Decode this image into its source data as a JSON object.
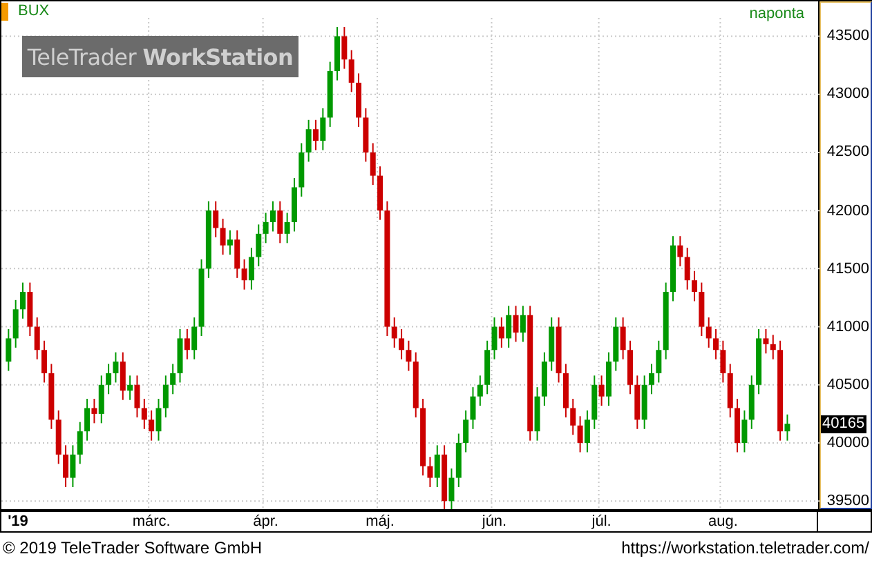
{
  "chart": {
    "symbol": "BUX",
    "interval": "naponta",
    "logo": "TeleTrader **WorkStation**",
    "last_price": "40165",
    "year_label": "'19",
    "chart_data": {
      "type": "candlestick",
      "grid": true,
      "ylim": [
        39430,
        43800
      ],
      "categories": [
        null,
        null,
        null,
        null,
        null,
        null,
        null,
        null,
        null,
        null,
        null,
        null,
        null,
        null,
        null,
        null,
        null,
        null,
        null,
        null,
        "márc.",
        null,
        null,
        null,
        null,
        null,
        null,
        null,
        null,
        null,
        null,
        null,
        null,
        null,
        null,
        null,
        "ápr.",
        null,
        null,
        null,
        null,
        null,
        null,
        null,
        null,
        null,
        null,
        null,
        null,
        null,
        null,
        null,
        "máj.",
        null,
        null,
        null,
        null,
        null,
        null,
        null,
        null,
        null,
        null,
        null,
        null,
        null,
        null,
        null,
        "jún.",
        null,
        null,
        null,
        null,
        null,
        null,
        null,
        null,
        null,
        null,
        null,
        null,
        null,
        null,
        "júl.",
        null,
        null,
        null,
        null,
        null,
        null,
        null,
        null,
        null,
        null,
        null,
        null,
        null,
        null,
        null,
        null,
        "aug.",
        null,
        null,
        null,
        null,
        null,
        null,
        null,
        null,
        null
      ],
      "ohlc": [
        [
          40700,
          40980,
          40620,
          40900
        ],
        [
          40900,
          41230,
          40820,
          41150
        ],
        [
          41150,
          41380,
          41070,
          41300
        ],
        [
          41300,
          41380,
          40920,
          41000
        ],
        [
          41000,
          41080,
          40720,
          40800
        ],
        [
          40800,
          40880,
          40520,
          40600
        ],
        [
          40600,
          40680,
          40120,
          40200
        ],
        [
          40200,
          40280,
          39820,
          39900
        ],
        [
          39900,
          39980,
          39620,
          39700
        ],
        [
          39700,
          39980,
          39620,
          39900
        ],
        [
          39900,
          40180,
          39820,
          40100
        ],
        [
          40100,
          40380,
          40020,
          40300
        ],
        [
          40300,
          40380,
          40170,
          40250
        ],
        [
          40250,
          40580,
          40170,
          40500
        ],
        [
          40500,
          40680,
          40420,
          40600
        ],
        [
          40600,
          40780,
          40520,
          40700
        ],
        [
          40700,
          40780,
          40370,
          40450
        ],
        [
          40450,
          40580,
          40370,
          40500
        ],
        [
          40500,
          40580,
          40220,
          40300
        ],
        [
          40300,
          40380,
          40120,
          40200
        ],
        [
          40200,
          40280,
          40020,
          40100
        ],
        [
          40100,
          40380,
          40020,
          40300
        ],
        [
          40300,
          40580,
          40220,
          40500
        ],
        [
          40500,
          40680,
          40420,
          40600
        ],
        [
          40600,
          40980,
          40520,
          40900
        ],
        [
          40900,
          40980,
          40720,
          40800
        ],
        [
          40800,
          41080,
          40720,
          41000
        ],
        [
          41000,
          41580,
          40920,
          41500
        ],
        [
          41500,
          42080,
          41420,
          42000
        ],
        [
          42000,
          42080,
          41770,
          41850
        ],
        [
          41850,
          41930,
          41620,
          41700
        ],
        [
          41700,
          41830,
          41620,
          41750
        ],
        [
          41750,
          41830,
          41420,
          41500
        ],
        [
          41500,
          41580,
          41320,
          41400
        ],
        [
          41400,
          41680,
          41320,
          41600
        ],
        [
          41600,
          41880,
          41520,
          41800
        ],
        [
          41800,
          41980,
          41720,
          41900
        ],
        [
          41900,
          42080,
          41820,
          42000
        ],
        [
          42000,
          42080,
          41720,
          41800
        ],
        [
          41800,
          41980,
          41720,
          41900
        ],
        [
          41900,
          42280,
          41820,
          42200
        ],
        [
          42200,
          42580,
          42120,
          42500
        ],
        [
          42500,
          42780,
          42420,
          42700
        ],
        [
          42700,
          42780,
          42520,
          42600
        ],
        [
          42600,
          42880,
          42520,
          42800
        ],
        [
          42800,
          43280,
          42720,
          43200
        ],
        [
          43200,
          43580,
          43120,
          43500
        ],
        [
          43500,
          43580,
          43220,
          43300
        ],
        [
          43300,
          43380,
          43020,
          43100
        ],
        [
          43100,
          43180,
          42720,
          42800
        ],
        [
          42800,
          42880,
          42420,
          42500
        ],
        [
          42500,
          42580,
          42220,
          42300
        ],
        [
          42300,
          42380,
          41920,
          42000
        ],
        [
          42000,
          42080,
          40920,
          41000
        ],
        [
          41000,
          41080,
          40820,
          40900
        ],
        [
          40900,
          40980,
          40720,
          40800
        ],
        [
          40800,
          40880,
          40620,
          40700
        ],
        [
          40700,
          40780,
          40220,
          40300
        ],
        [
          40300,
          40380,
          39720,
          39800
        ],
        [
          39800,
          39880,
          39620,
          39700
        ],
        [
          39700,
          39980,
          39620,
          39900
        ],
        [
          39900,
          39980,
          39420,
          39500
        ],
        [
          39500,
          39780,
          39420,
          39700
        ],
        [
          39700,
          40080,
          39620,
          40000
        ],
        [
          40000,
          40280,
          39920,
          40200
        ],
        [
          40200,
          40480,
          40120,
          40400
        ],
        [
          40400,
          40580,
          40320,
          40500
        ],
        [
          40500,
          40880,
          40420,
          40800
        ],
        [
          40800,
          41080,
          40720,
          41000
        ],
        [
          41000,
          41080,
          40820,
          40900
        ],
        [
          40900,
          41180,
          40820,
          41100
        ],
        [
          41100,
          41180,
          40870,
          40950
        ],
        [
          40950,
          41180,
          40870,
          41100
        ],
        [
          41100,
          41180,
          40020,
          40100
        ],
        [
          40100,
          40480,
          40020,
          40400
        ],
        [
          40400,
          40780,
          40320,
          40700
        ],
        [
          40700,
          41080,
          40620,
          41000
        ],
        [
          41000,
          41080,
          40520,
          40600
        ],
        [
          40600,
          40680,
          40220,
          40300
        ],
        [
          40300,
          40380,
          40070,
          40150
        ],
        [
          40150,
          40230,
          39920,
          40000
        ],
        [
          40000,
          40280,
          39920,
          40200
        ],
        [
          40200,
          40580,
          40120,
          40500
        ],
        [
          40500,
          40580,
          40320,
          40400
        ],
        [
          40400,
          40780,
          40320,
          40700
        ],
        [
          40700,
          41080,
          40620,
          41000
        ],
        [
          41000,
          41080,
          40720,
          40800
        ],
        [
          40800,
          40880,
          40420,
          40500
        ],
        [
          40500,
          40580,
          40120,
          40200
        ],
        [
          40200,
          40580,
          40120,
          40500
        ],
        [
          40500,
          40680,
          40420,
          40600
        ],
        [
          40600,
          40880,
          40520,
          40800
        ],
        [
          40800,
          41380,
          40720,
          41300
        ],
        [
          41300,
          41780,
          41220,
          41700
        ],
        [
          41700,
          41780,
          41520,
          41600
        ],
        [
          41600,
          41680,
          41320,
          41400
        ],
        [
          41400,
          41480,
          41220,
          41300
        ],
        [
          41300,
          41380,
          40920,
          41000
        ],
        [
          41000,
          41080,
          40820,
          40900
        ],
        [
          40900,
          40980,
          40720,
          40800
        ],
        [
          40800,
          40880,
          40520,
          40600
        ],
        [
          40600,
          40680,
          40220,
          40300
        ],
        [
          40300,
          40380,
          39920,
          40000
        ],
        [
          40000,
          40280,
          39920,
          40200
        ],
        [
          40200,
          40580,
          40120,
          40500
        ],
        [
          40500,
          40980,
          40420,
          40900
        ],
        [
          40900,
          40980,
          40770,
          40850
        ],
        [
          40850,
          40930,
          40720,
          40800
        ],
        [
          40800,
          40880,
          40020,
          40100
        ],
        [
          40100,
          40245,
          40020,
          40165
        ]
      ],
      "yticks": [
        {
          "value": 43500,
          "label": "43500"
        },
        {
          "value": 43000,
          "label": "43000"
        },
        {
          "value": 42500,
          "label": "42500"
        },
        {
          "value": 42000,
          "label": "42000"
        },
        {
          "value": 41500,
          "label": "41500"
        },
        {
          "value": 41000,
          "label": "41000"
        },
        {
          "value": 40500,
          "label": "40500"
        },
        {
          "value": 40000,
          "label": "40000"
        },
        {
          "value": 39500,
          "label": "39500"
        }
      ]
    }
  },
  "footer": {
    "copyright": "© 2019 TeleTrader Software GmbH",
    "url": "https://workstation.teletrader.com/"
  }
}
